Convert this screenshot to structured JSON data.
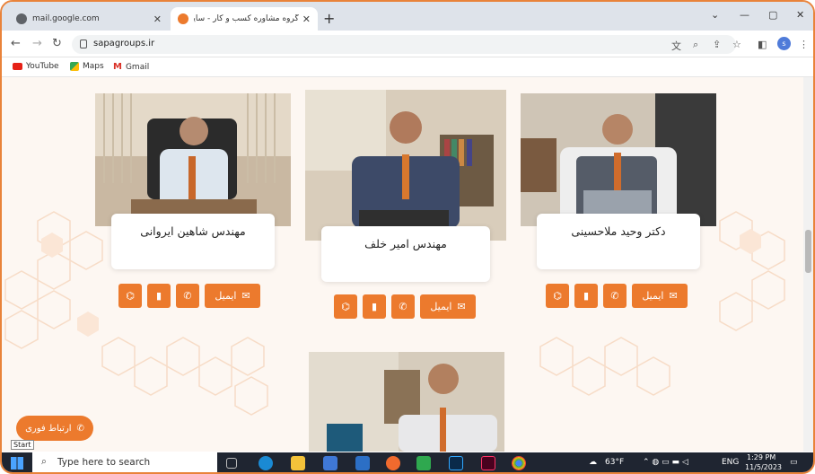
{
  "browser": {
    "tabs": [
      {
        "label": "mail.google.com",
        "active": false
      },
      {
        "label": "گروه مشاوره کسب و کار - سایـ ا |",
        "active": true
      }
    ],
    "url": "sapagroups.ir",
    "profile_initial": "s",
    "bookmarks": [
      "YouTube",
      "Maps",
      "Gmail"
    ]
  },
  "accent_color": "#ec7a2d",
  "consultants": [
    {
      "name": "مهندس شاهین ایروانی",
      "email_label": "ایمیل"
    },
    {
      "name": "مهندس امیر خلف",
      "email_label": "ایمیل"
    },
    {
      "name": "دکتر وحید ملاحسینی",
      "email_label": "ایمیل"
    }
  ],
  "contact_button": "ارتباط فوری",
  "start_tooltip": "Start",
  "taskbar": {
    "search_placeholder": "Type here to search",
    "weather": "63°F",
    "language": "ENG",
    "time": "1:29 PM",
    "date": "11/5/2023"
  }
}
